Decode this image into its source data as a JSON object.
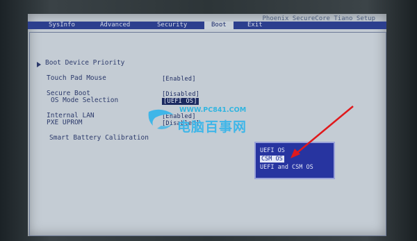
{
  "bios": {
    "title": "Phoenix SecureCore Tiano Setup",
    "tabs": [
      {
        "label": "SysInfo",
        "active": false
      },
      {
        "label": "Advanced",
        "active": false
      },
      {
        "label": "Security",
        "active": false
      },
      {
        "label": "Boot",
        "active": true
      },
      {
        "label": "Exit",
        "active": false
      }
    ],
    "items": {
      "boot_device_priority": "Boot Device Priority",
      "touch_pad_mouse": "Touch Pad Mouse",
      "touch_pad_mouse_value": "[Enabled]",
      "secure_boot": "Secure Boot",
      "secure_boot_value": "[Disabled]",
      "os_mode_selection": "OS Mode Selection",
      "os_mode_selection_value": "[UEFI OS]",
      "internal_lan": "Internal LAN",
      "internal_lan_value": "[Enabled]",
      "pxe_uprom": "PXE UPROM",
      "pxe_uprom_value": "[Disabled]",
      "smart_battery_calibration": "Smart Battery Calibration"
    },
    "popup_options": [
      {
        "label": "UEFI OS",
        "selected": false
      },
      {
        "label": "CSM OS",
        "selected": true
      },
      {
        "label": "UEFI and CSM OS",
        "selected": false
      }
    ]
  },
  "watermark": {
    "url": "WWW.PC841.COM",
    "text": "电脑百事网"
  },
  "colors": {
    "tab_bar": "#2c3f8e",
    "popup_bg": "#2734a0",
    "annotation_arrow": "#e0191c",
    "watermark": "#3fb6e8"
  }
}
